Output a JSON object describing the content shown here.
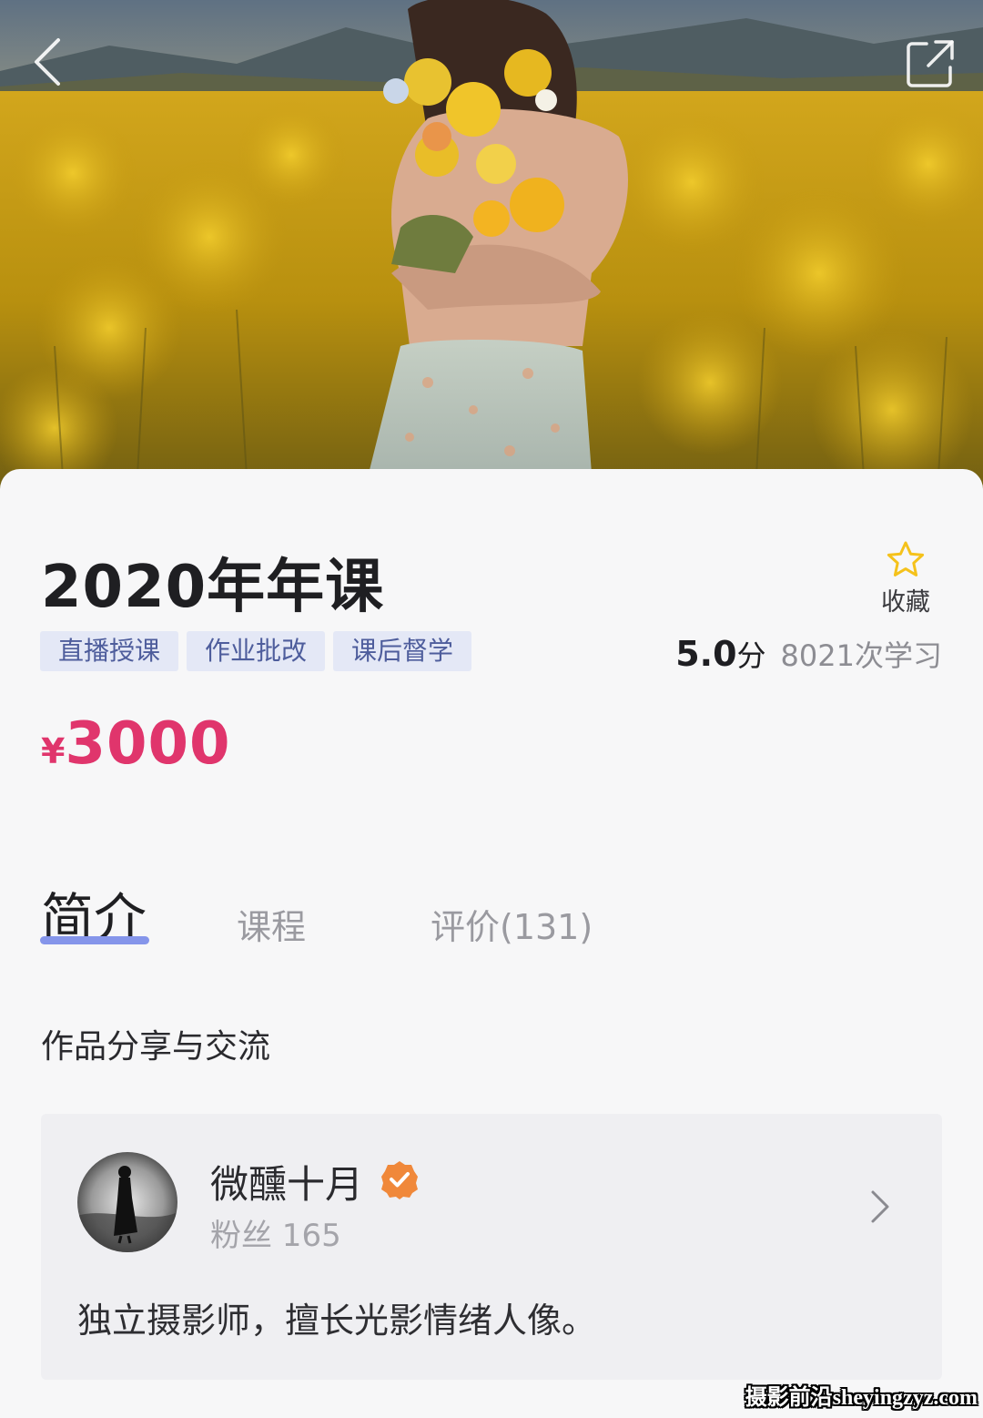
{
  "course": {
    "title": "2020年年课",
    "favorite_label": "收藏",
    "tags": [
      "直播授课",
      "作业批改",
      "课后督学"
    ],
    "rating_value": "5.0",
    "rating_unit": "分",
    "learn_count": "8021次学习",
    "price_symbol": "¥",
    "price_value": "3000"
  },
  "tabs": [
    {
      "label": "简介",
      "active": true
    },
    {
      "label": "课程",
      "active": false
    },
    {
      "label": "评价(131)",
      "active": false
    }
  ],
  "section_heading": "作品分享与交流",
  "author": {
    "name": "微醺十月",
    "followers_label": "粉丝 165",
    "bio": "独立摄影师，擅长光影情绪人像。"
  },
  "watermark": "摄影前沿sheyingzyz.com",
  "colors": {
    "accent_price": "#e0356c",
    "tag_background": "#e4e8f6",
    "tag_text": "#4e5d9c",
    "tab_indicator": "#8595ea",
    "verified_badge": "#f0883a",
    "favorite_star": "#f5c21b"
  },
  "icons": {
    "back": "chevron-left-icon",
    "share": "share-external-icon",
    "favorite": "star-outline-icon",
    "verified": "verified-check-icon",
    "card_arrow": "chevron-right-icon"
  }
}
